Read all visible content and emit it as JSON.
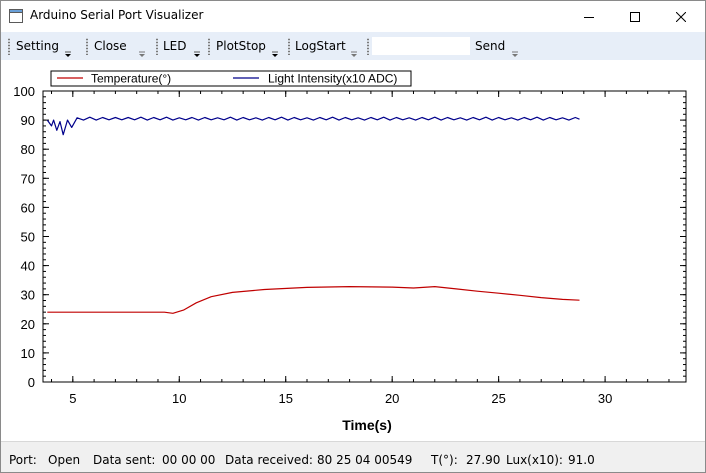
{
  "window": {
    "title": "Arduino Serial Port Visualizer",
    "minimize_icon": "minimize-icon",
    "maximize_icon": "maximize-icon",
    "close_icon": "close-icon"
  },
  "toolbar": {
    "setting_label": "Setting",
    "close_label": "Close",
    "led_label": "LED",
    "plotstop_label": "PlotStop",
    "logstart_label": "LogStart",
    "send_input_value": "",
    "send_label": "Send"
  },
  "chart_data": {
    "type": "line",
    "xlabel": "Time(s)",
    "ylabel": "",
    "xlim": [
      3.6,
      33.8
    ],
    "ylim": [
      0,
      100
    ],
    "x_ticks": [
      5,
      10,
      15,
      20,
      25,
      30
    ],
    "y_ticks": [
      0,
      10,
      20,
      30,
      40,
      50,
      60,
      70,
      80,
      90,
      100
    ],
    "grid": false,
    "legend_position": "top-left",
    "series": [
      {
        "name": "Temperature(°)",
        "color": "#c00000",
        "points": [
          [
            3.8,
            24
          ],
          [
            9.3,
            24
          ],
          [
            9.7,
            23.6
          ],
          [
            10.2,
            24.7
          ],
          [
            10.8,
            27.2
          ],
          [
            11.5,
            29.3
          ],
          [
            12.5,
            30.8
          ],
          [
            14,
            31.8
          ],
          [
            16,
            32.5
          ],
          [
            18,
            32.8
          ],
          [
            20,
            32.6
          ],
          [
            21,
            32.3
          ],
          [
            22,
            32.8
          ],
          [
            23,
            32
          ],
          [
            24,
            31.2
          ],
          [
            25,
            30.5
          ],
          [
            26,
            29.8
          ],
          [
            27,
            29
          ],
          [
            28,
            28.4
          ],
          [
            28.8,
            28.1
          ]
        ]
      },
      {
        "name": "Light Intensity(x10 ADC)",
        "color": "#00008b",
        "points": [
          [
            3.8,
            90
          ],
          [
            4.0,
            88
          ],
          [
            4.1,
            90
          ],
          [
            4.25,
            86.5
          ],
          [
            4.4,
            89.5
          ],
          [
            4.55,
            85
          ],
          [
            4.75,
            90
          ],
          [
            4.95,
            87.5
          ],
          [
            5.2,
            90.8
          ],
          [
            5.5,
            90
          ],
          [
            5.8,
            91
          ],
          [
            6.1,
            90
          ],
          [
            6.4,
            90.9
          ],
          [
            6.7,
            90.1
          ],
          [
            7.0,
            90.9
          ],
          [
            7.3,
            90.1
          ],
          [
            7.6,
            90.9
          ],
          [
            7.9,
            90.1
          ],
          [
            8.2,
            91
          ],
          [
            8.5,
            90
          ],
          [
            8.8,
            90.9
          ],
          [
            9.1,
            90.1
          ],
          [
            9.4,
            91
          ],
          [
            9.7,
            90
          ],
          [
            10.0,
            90.8
          ],
          [
            10.3,
            90.1
          ],
          [
            10.6,
            90.9
          ],
          [
            10.9,
            90
          ],
          [
            11.2,
            90.9
          ],
          [
            11.5,
            90.1
          ],
          [
            11.8,
            90.8
          ],
          [
            12.1,
            90.1
          ],
          [
            12.4,
            91
          ],
          [
            12.7,
            90
          ],
          [
            13.0,
            90.9
          ],
          [
            13.3,
            90.1
          ],
          [
            13.6,
            90.8
          ],
          [
            13.9,
            90
          ],
          [
            14.2,
            90.9
          ],
          [
            14.5,
            90.1
          ],
          [
            14.8,
            91
          ],
          [
            15.1,
            90
          ],
          [
            15.4,
            90.9
          ],
          [
            15.7,
            90.1
          ],
          [
            16.0,
            90.8
          ],
          [
            16.3,
            90
          ],
          [
            16.6,
            90.9
          ],
          [
            16.9,
            90.1
          ],
          [
            17.2,
            91
          ],
          [
            17.5,
            90
          ],
          [
            17.8,
            90.9
          ],
          [
            18.1,
            90.1
          ],
          [
            18.4,
            90.8
          ],
          [
            18.7,
            90
          ],
          [
            19.0,
            90.9
          ],
          [
            19.3,
            90.1
          ],
          [
            19.6,
            91
          ],
          [
            19.9,
            90
          ],
          [
            20.2,
            90.9
          ],
          [
            20.5,
            90.1
          ],
          [
            20.8,
            90.8
          ],
          [
            21.1,
            90
          ],
          [
            21.4,
            90.9
          ],
          [
            21.7,
            90.1
          ],
          [
            22.0,
            91
          ],
          [
            22.3,
            90
          ],
          [
            22.6,
            90.9
          ],
          [
            22.9,
            90.1
          ],
          [
            23.2,
            90.8
          ],
          [
            23.5,
            90
          ],
          [
            23.8,
            90.9
          ],
          [
            24.1,
            90.1
          ],
          [
            24.4,
            91
          ],
          [
            24.7,
            90
          ],
          [
            25.0,
            90.9
          ],
          [
            25.3,
            90.1
          ],
          [
            25.6,
            90.8
          ],
          [
            25.9,
            90
          ],
          [
            26.2,
            90.9
          ],
          [
            26.5,
            90.1
          ],
          [
            26.8,
            91
          ],
          [
            27.1,
            90
          ],
          [
            27.4,
            90.9
          ],
          [
            27.7,
            90.1
          ],
          [
            28.0,
            90.8
          ],
          [
            28.3,
            90
          ],
          [
            28.6,
            90.9
          ],
          [
            28.8,
            90.3
          ]
        ]
      }
    ]
  },
  "status": {
    "port_label": "Port:",
    "port_value": "Open",
    "sent_label": "Data sent:",
    "sent_value": "00 00 00",
    "received_label": "Data received:",
    "received_value": "80 25 04  00549",
    "temp_label": "T(°):",
    "temp_value": "27.90",
    "lux_label": "Lux(x10):",
    "lux_value": "91.0"
  }
}
